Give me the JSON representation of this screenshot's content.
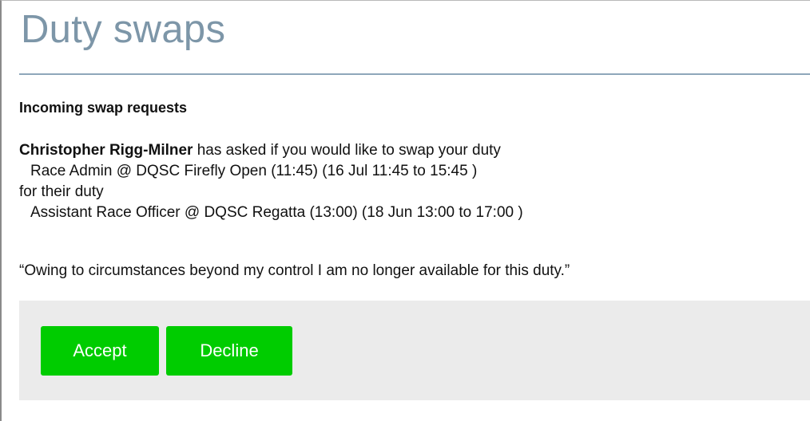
{
  "page": {
    "title": "Duty swaps"
  },
  "incoming": {
    "heading": "Incoming swap requests",
    "request": {
      "requester": "Christopher Rigg-Milner",
      "ask_text": " has asked if you would like to swap your duty",
      "your_duty": "Race Admin @ DQSC Firefly Open (11:45) (16 Jul 11:45 to 15:45 )",
      "for_text": "for their duty",
      "their_duty": "Assistant Race Officer @ DQSC Regatta (13:00) (18 Jun 13:00 to 17:00 )",
      "reason": "“Owing to circumstances beyond my control I am no longer available for this duty.”"
    }
  },
  "actions": {
    "accept_label": "Accept",
    "decline_label": "Decline"
  },
  "colors": {
    "title": "#7d96a8",
    "rule": "#8ea7ba",
    "button": "#00cc00",
    "action_panel": "#ebebeb"
  }
}
